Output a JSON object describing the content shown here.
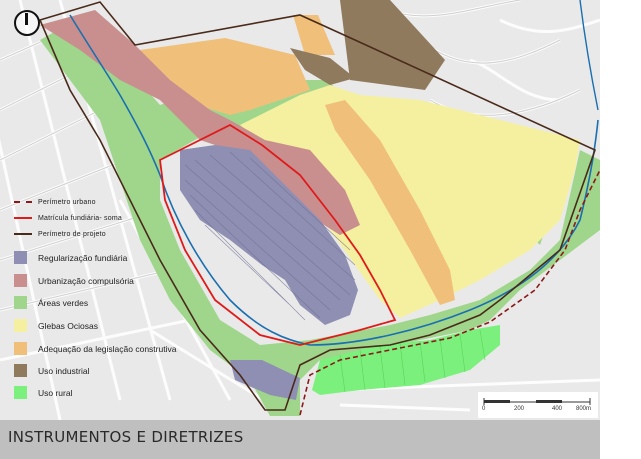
{
  "colors": {
    "regularizacao": "#8f8fb3",
    "urbanizacao": "#c98f8f",
    "areas_verdes": "#9fd68c",
    "glebas": "#f5f0a0",
    "adequacao": "#f0c07a",
    "industrial": "#8f7a5e",
    "rural": "#7cf07c",
    "perimetro_urbano": "#8b1a1a",
    "matricula": "#e01a1a",
    "perimetro_projeto": "#4a2a1a",
    "river": "#1a6fb0"
  },
  "legend": {
    "lines": [
      {
        "label": "Perímetro urbano",
        "key": "perimetro_urbano",
        "dash": true
      },
      {
        "label": "Matrícula fundiária- soma",
        "key": "matricula",
        "dash": false
      },
      {
        "label": "Perímetro de projeto",
        "key": "perimetro_projeto",
        "dash": false
      }
    ],
    "areas": [
      {
        "label": "Regularização fundiária",
        "key": "regularizacao"
      },
      {
        "label": "Urbanização compulsória",
        "key": "urbanizacao"
      },
      {
        "label": "Áreas verdes",
        "key": "areas_verdes"
      },
      {
        "label": "Glebas Ociosas",
        "key": "glebas"
      },
      {
        "label": "Adequação da legislação construtiva",
        "key": "adequacao"
      },
      {
        "label": "Uso industrial",
        "key": "industrial"
      },
      {
        "label": "Uso rural",
        "key": "rural"
      }
    ]
  },
  "scale": {
    "labels": [
      "0",
      "200",
      "400",
      "800m"
    ]
  },
  "footer": {
    "title": "INSTRUMENTOS E DIRETRIZES"
  },
  "north_icon": "north-arrow-icon"
}
